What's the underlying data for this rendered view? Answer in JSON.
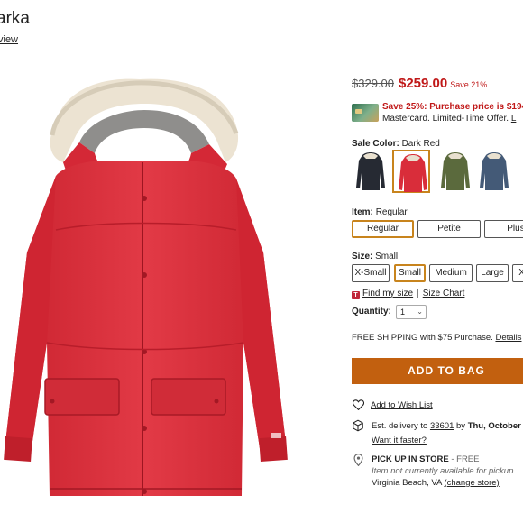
{
  "product": {
    "title": "arka",
    "review_link": "view"
  },
  "price": {
    "original": "$329.00",
    "sale": "$259.00",
    "save": "Save 21%"
  },
  "promo": {
    "line1": "Save 25%: Purchase price is $194",
    "line2_text": "Mastercard. Limited-Time Offer.",
    "line2_link": "L"
  },
  "color": {
    "label": "Sale Color:",
    "value": "Dark Red",
    "swatches": [
      "Black",
      "Dark Red",
      "Olive",
      "Blue"
    ],
    "selected_index": 1
  },
  "item": {
    "label": "Item:",
    "value": "Regular",
    "options": [
      "Regular",
      "Petite",
      "Plus"
    ],
    "selected": "Regular"
  },
  "size": {
    "label": "Size:",
    "value": "Small",
    "options": [
      "X-Small",
      "Small",
      "Medium",
      "Large",
      "X-L"
    ],
    "selected": "Small",
    "find_my_size": "Find my size",
    "separator": "|",
    "size_chart": "Size Chart"
  },
  "quantity": {
    "label": "Quantity:",
    "value": "1"
  },
  "shipping": {
    "text": "FREE SHIPPING with $75 Purchase.",
    "link": "Details"
  },
  "add_to_bag": "ADD TO BAG",
  "wishlist": "Add to Wish List",
  "delivery": {
    "prefix": "Est. delivery to",
    "zip": "33601",
    "mid": "by",
    "date": "Thu, October",
    "faster": "Want it faster?"
  },
  "pickup": {
    "title": "PICK UP IN STORE",
    "free": "- FREE",
    "status": "Item not currently available for pickup",
    "store": "Virginia Beach, VA",
    "change": "(change store)"
  },
  "colors": {
    "accent_orange": "#c2600f",
    "selected_border": "#c8841d",
    "sale_red": "#c01818",
    "jacket_red": "#d92d3a"
  }
}
